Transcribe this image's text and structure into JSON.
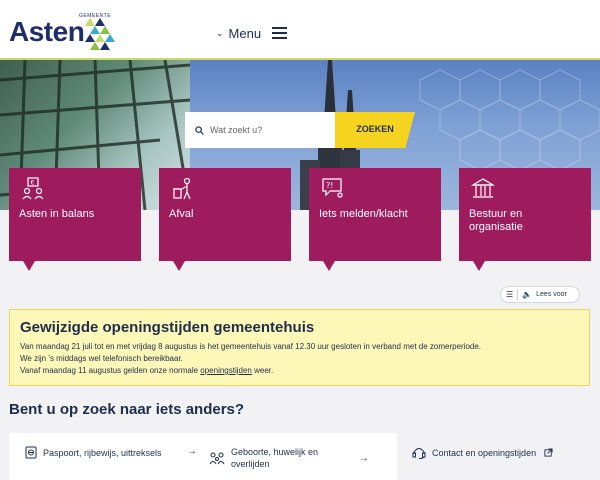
{
  "header": {
    "logo_text": "Asten",
    "logo_sub": "GEMEENTE",
    "menu_label": "Menu",
    "colors": {
      "navy": "#1f2d6b",
      "accent_green": "#c9d96a"
    }
  },
  "search": {
    "placeholder": "Wat zoekt u?",
    "button_label": "ZOEKEN"
  },
  "tiles": [
    {
      "label": "Asten in balans",
      "icon": "balance-people-icon"
    },
    {
      "label": "Afval",
      "icon": "waste-person-icon"
    },
    {
      "label": "Iets melden/klacht",
      "icon": "report-speech-icon"
    },
    {
      "label": "Bestuur en organisatie",
      "icon": "townhall-icon"
    }
  ],
  "read_aloud": {
    "label": "Lees voor"
  },
  "notice": {
    "title": "Gewijzigde openingstijden gemeentehuis",
    "line1": "Van maandag 21 juli tot en met vrijdag 8 augustus is het gemeentehuis vanaf 12.30 uur gesloten in verband met de zomerperiode.",
    "line2": "We zijn ’s middags wel telefonisch bereikbaar.",
    "line3_pre": "Vanaf maandag 11 augustus gelden onze normale ",
    "line3_link": "openingstijden",
    "line3_post": " weer."
  },
  "section_title": "Bent u op zoek naar iets anders?",
  "links": [
    {
      "label": "Paspoort, rijbewijs, uittreksels"
    },
    {
      "label": "Geboorte, huwelijk en overlijden"
    }
  ],
  "side_links": [
    {
      "label": "Contact en openingstijden"
    }
  ]
}
